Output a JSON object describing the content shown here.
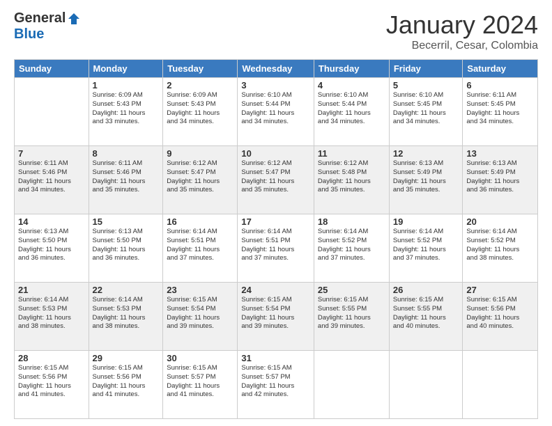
{
  "logo": {
    "general": "General",
    "blue": "Blue"
  },
  "header": {
    "title": "January 2024",
    "subtitle": "Becerril, Cesar, Colombia"
  },
  "calendar": {
    "days_of_week": [
      "Sunday",
      "Monday",
      "Tuesday",
      "Wednesday",
      "Thursday",
      "Friday",
      "Saturday"
    ],
    "weeks": [
      [
        {
          "day": "",
          "info": ""
        },
        {
          "day": "1",
          "info": "Sunrise: 6:09 AM\nSunset: 5:43 PM\nDaylight: 11 hours\nand 33 minutes."
        },
        {
          "day": "2",
          "info": "Sunrise: 6:09 AM\nSunset: 5:43 PM\nDaylight: 11 hours\nand 34 minutes."
        },
        {
          "day": "3",
          "info": "Sunrise: 6:10 AM\nSunset: 5:44 PM\nDaylight: 11 hours\nand 34 minutes."
        },
        {
          "day": "4",
          "info": "Sunrise: 6:10 AM\nSunset: 5:44 PM\nDaylight: 11 hours\nand 34 minutes."
        },
        {
          "day": "5",
          "info": "Sunrise: 6:10 AM\nSunset: 5:45 PM\nDaylight: 11 hours\nand 34 minutes."
        },
        {
          "day": "6",
          "info": "Sunrise: 6:11 AM\nSunset: 5:45 PM\nDaylight: 11 hours\nand 34 minutes."
        }
      ],
      [
        {
          "day": "7",
          "info": "Sunrise: 6:11 AM\nSunset: 5:46 PM\nDaylight: 11 hours\nand 34 minutes."
        },
        {
          "day": "8",
          "info": "Sunrise: 6:11 AM\nSunset: 5:46 PM\nDaylight: 11 hours\nand 35 minutes."
        },
        {
          "day": "9",
          "info": "Sunrise: 6:12 AM\nSunset: 5:47 PM\nDaylight: 11 hours\nand 35 minutes."
        },
        {
          "day": "10",
          "info": "Sunrise: 6:12 AM\nSunset: 5:47 PM\nDaylight: 11 hours\nand 35 minutes."
        },
        {
          "day": "11",
          "info": "Sunrise: 6:12 AM\nSunset: 5:48 PM\nDaylight: 11 hours\nand 35 minutes."
        },
        {
          "day": "12",
          "info": "Sunrise: 6:13 AM\nSunset: 5:49 PM\nDaylight: 11 hours\nand 35 minutes."
        },
        {
          "day": "13",
          "info": "Sunrise: 6:13 AM\nSunset: 5:49 PM\nDaylight: 11 hours\nand 36 minutes."
        }
      ],
      [
        {
          "day": "14",
          "info": "Sunrise: 6:13 AM\nSunset: 5:50 PM\nDaylight: 11 hours\nand 36 minutes."
        },
        {
          "day": "15",
          "info": "Sunrise: 6:13 AM\nSunset: 5:50 PM\nDaylight: 11 hours\nand 36 minutes."
        },
        {
          "day": "16",
          "info": "Sunrise: 6:14 AM\nSunset: 5:51 PM\nDaylight: 11 hours\nand 37 minutes."
        },
        {
          "day": "17",
          "info": "Sunrise: 6:14 AM\nSunset: 5:51 PM\nDaylight: 11 hours\nand 37 minutes."
        },
        {
          "day": "18",
          "info": "Sunrise: 6:14 AM\nSunset: 5:52 PM\nDaylight: 11 hours\nand 37 minutes."
        },
        {
          "day": "19",
          "info": "Sunrise: 6:14 AM\nSunset: 5:52 PM\nDaylight: 11 hours\nand 37 minutes."
        },
        {
          "day": "20",
          "info": "Sunrise: 6:14 AM\nSunset: 5:52 PM\nDaylight: 11 hours\nand 38 minutes."
        }
      ],
      [
        {
          "day": "21",
          "info": "Sunrise: 6:14 AM\nSunset: 5:53 PM\nDaylight: 11 hours\nand 38 minutes."
        },
        {
          "day": "22",
          "info": "Sunrise: 6:14 AM\nSunset: 5:53 PM\nDaylight: 11 hours\nand 38 minutes."
        },
        {
          "day": "23",
          "info": "Sunrise: 6:15 AM\nSunset: 5:54 PM\nDaylight: 11 hours\nand 39 minutes."
        },
        {
          "day": "24",
          "info": "Sunrise: 6:15 AM\nSunset: 5:54 PM\nDaylight: 11 hours\nand 39 minutes."
        },
        {
          "day": "25",
          "info": "Sunrise: 6:15 AM\nSunset: 5:55 PM\nDaylight: 11 hours\nand 39 minutes."
        },
        {
          "day": "26",
          "info": "Sunrise: 6:15 AM\nSunset: 5:55 PM\nDaylight: 11 hours\nand 40 minutes."
        },
        {
          "day": "27",
          "info": "Sunrise: 6:15 AM\nSunset: 5:56 PM\nDaylight: 11 hours\nand 40 minutes."
        }
      ],
      [
        {
          "day": "28",
          "info": "Sunrise: 6:15 AM\nSunset: 5:56 PM\nDaylight: 11 hours\nand 41 minutes."
        },
        {
          "day": "29",
          "info": "Sunrise: 6:15 AM\nSunset: 5:56 PM\nDaylight: 11 hours\nand 41 minutes."
        },
        {
          "day": "30",
          "info": "Sunrise: 6:15 AM\nSunset: 5:57 PM\nDaylight: 11 hours\nand 41 minutes."
        },
        {
          "day": "31",
          "info": "Sunrise: 6:15 AM\nSunset: 5:57 PM\nDaylight: 11 hours\nand 42 minutes."
        },
        {
          "day": "",
          "info": ""
        },
        {
          "day": "",
          "info": ""
        },
        {
          "day": "",
          "info": ""
        }
      ]
    ]
  }
}
